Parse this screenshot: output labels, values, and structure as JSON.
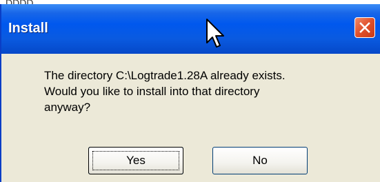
{
  "background": {
    "partial_text": "DDDD"
  },
  "dialog": {
    "title": "Install",
    "message_lines": [
      "The directory C:\\Logtrade1.28A already exists.",
      "Would you like to install into that directory",
      "anyway?"
    ],
    "buttons": {
      "yes": "Yes",
      "no": "No"
    },
    "focused_button": "yes"
  },
  "icons": {
    "close": "close-icon",
    "cursor": "mouse-pointer-icon"
  },
  "colors": {
    "titlebar": "#0058ee",
    "dialog_bg": "#ece9d8",
    "close_button": "#e0502a",
    "border": "#0a3ec6"
  }
}
